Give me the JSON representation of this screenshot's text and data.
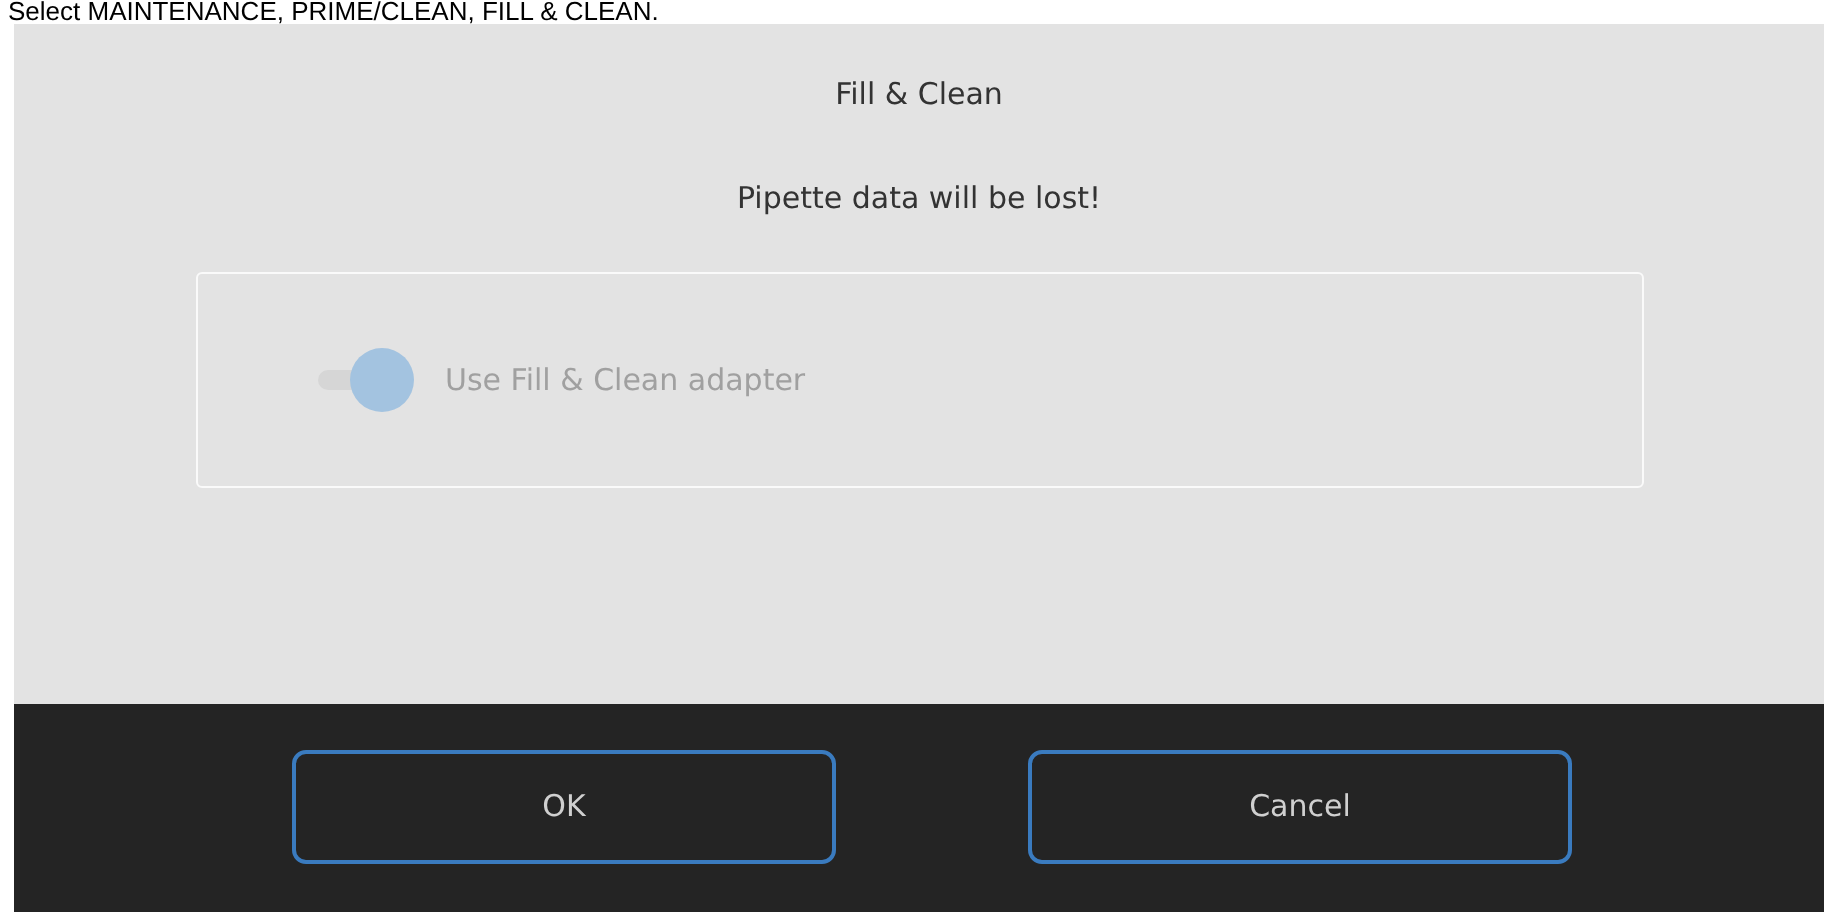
{
  "caption": "Select MAINTENANCE, PRIME/CLEAN, FILL & CLEAN.",
  "dialog": {
    "title": "Fill & Clean",
    "message": "Pipette data will be lost!",
    "toggle": {
      "label": "Use Fill & Clean adapter",
      "on": true,
      "disabled": true
    },
    "buttons": [
      {
        "label": "OK"
      },
      {
        "label": "Cancel"
      }
    ]
  }
}
